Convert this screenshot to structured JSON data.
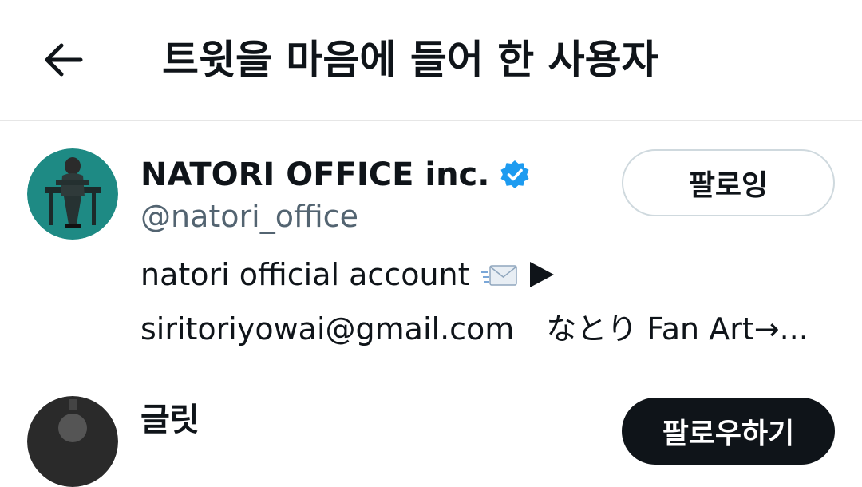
{
  "header": {
    "back_icon": "arrow-left-icon",
    "title": "트윗을 마음에 들어 한 사용자"
  },
  "users": [
    {
      "display_name": "NATORI OFFICE inc.",
      "verified": true,
      "handle": "@natori_office",
      "bio_line1": "natori official account",
      "bio_line2_email": "siritoriyowai@gmail.com",
      "bio_line2_rest": "なとり Fan Art→...",
      "follow_label": "팔로잉",
      "avatar_color": "#1e8a84"
    },
    {
      "display_name": "글릿",
      "follow_label": "팔로우하기",
      "avatar_color": "#2a2a2a"
    }
  ],
  "colors": {
    "verified_blue": "#1d9bf0",
    "secondary_text": "#536471",
    "divider": "#e6e6e6"
  }
}
